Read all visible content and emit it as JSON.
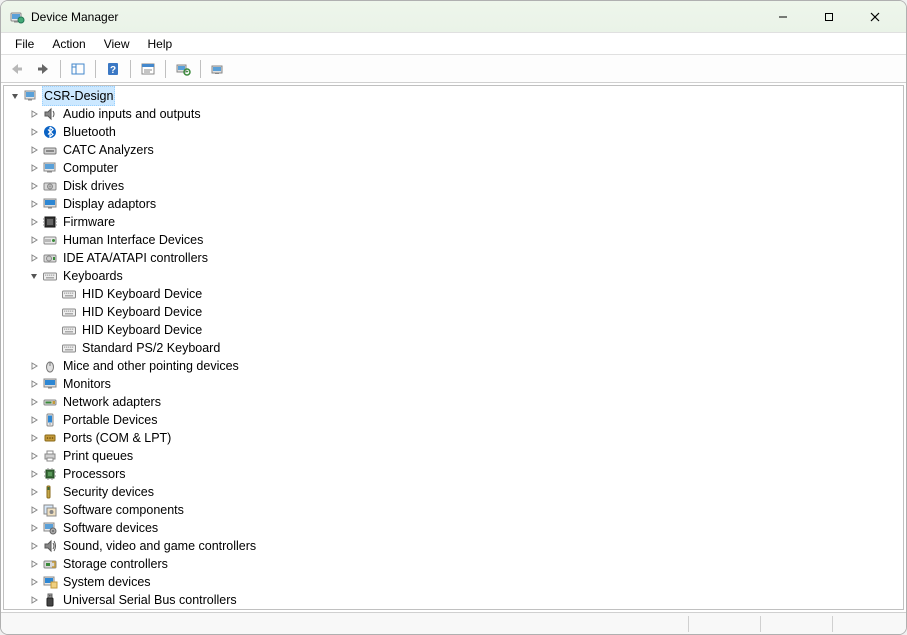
{
  "window": {
    "title": "Device Manager"
  },
  "menu": {
    "file": "File",
    "action": "Action",
    "view": "View",
    "help": "Help"
  },
  "root": {
    "label": "CSR-Design"
  },
  "categories": [
    {
      "icon": "audio",
      "label": "Audio inputs and outputs"
    },
    {
      "icon": "bluetooth",
      "label": "Bluetooth"
    },
    {
      "icon": "catc",
      "label": "CATC Analyzers"
    },
    {
      "icon": "computer",
      "label": "Computer"
    },
    {
      "icon": "disk",
      "label": "Disk drives"
    },
    {
      "icon": "display",
      "label": "Display adaptors"
    },
    {
      "icon": "firmware",
      "label": "Firmware"
    },
    {
      "icon": "hid",
      "label": "Human Interface Devices"
    },
    {
      "icon": "ide",
      "label": "IDE ATA/ATAPI controllers"
    },
    {
      "icon": "keyboard",
      "label": "Keyboards",
      "expanded": true,
      "children": [
        {
          "icon": "keyboard",
          "label": "HID Keyboard Device"
        },
        {
          "icon": "keyboard",
          "label": "HID Keyboard Device"
        },
        {
          "icon": "keyboard",
          "label": "HID Keyboard Device"
        },
        {
          "icon": "keyboard",
          "label": "Standard PS/2 Keyboard"
        }
      ]
    },
    {
      "icon": "mouse",
      "label": "Mice and other pointing devices"
    },
    {
      "icon": "monitor",
      "label": "Monitors"
    },
    {
      "icon": "network",
      "label": "Network adapters"
    },
    {
      "icon": "portable",
      "label": "Portable Devices"
    },
    {
      "icon": "port",
      "label": "Ports (COM & LPT)"
    },
    {
      "icon": "printer",
      "label": "Print queues"
    },
    {
      "icon": "cpu",
      "label": "Processors"
    },
    {
      "icon": "security",
      "label": "Security devices"
    },
    {
      "icon": "swcomp",
      "label": "Software components"
    },
    {
      "icon": "swdev",
      "label": "Software devices"
    },
    {
      "icon": "sound",
      "label": "Sound, video and game controllers"
    },
    {
      "icon": "storage",
      "label": "Storage controllers"
    },
    {
      "icon": "system",
      "label": "System devices"
    },
    {
      "icon": "usb",
      "label": "Universal Serial Bus controllers"
    }
  ]
}
